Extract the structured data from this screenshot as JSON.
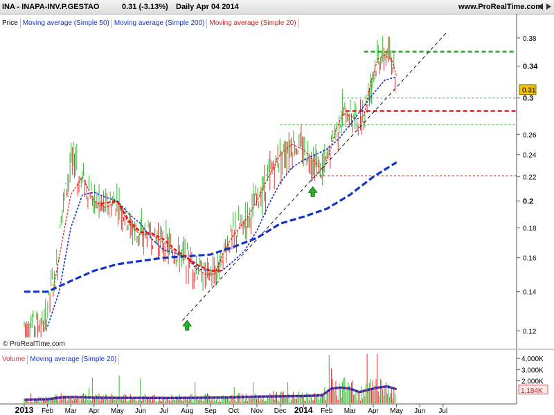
{
  "title_bar": {
    "symbol": "INA - INAPA-INV.P.GESTAO",
    "quote": "0.31 (-3.13%)",
    "period_date": "Daily  Apr 04 2014",
    "site": "www.ProRealTime.com"
  },
  "price_legend": [
    "Price",
    "Moving average (Simple 50)",
    "Moving average (Simple 200)",
    "Moving average (Simple 20)"
  ],
  "volume_legend": [
    "Volume",
    "Moving average (Simple 20)"
  ],
  "copyright": "© ProRealTime.com",
  "colors": {
    "up": "#33bb33",
    "down": "#dd3333",
    "sma20": "#ee1111",
    "sma50": "#1133cc",
    "sma200": "#1133cc",
    "level_green": "#22aa22",
    "level_red": "#ee1111",
    "last_badge": "#f2c200"
  },
  "chart_data": [
    {
      "type": "line",
      "panel": "price",
      "y_scale": "log",
      "ylim": [
        0.115,
        0.4
      ],
      "y_ticks": [
        0.12,
        0.14,
        0.16,
        0.18,
        0.2,
        0.22,
        0.24,
        0.26,
        0.3,
        0.34,
        0.38
      ],
      "y_tick_labels": [
        "0.12",
        "0.14",
        "0.16",
        "0.18",
        "0.2",
        "0.22",
        "0.24",
        "0.26",
        "0.3",
        "0.34",
        "0.38"
      ],
      "x_range_months": [
        0,
        18.5
      ],
      "last_price": 0.31,
      "last_price_label": "0.31",
      "series": [
        {
          "name": "Moving average (Simple 20)",
          "x": [
            1.3,
            2.0,
            2.5,
            3.0,
            3.5,
            4.0,
            4.5,
            5.0,
            5.5,
            6.0,
            6.5,
            7.0,
            7.4,
            7.8,
            8.2,
            8.6,
            9.0,
            9.5,
            10.0,
            10.5,
            11.0,
            11.5,
            12.0,
            12.5,
            12.8,
            13.1,
            13.4,
            13.7,
            14.0,
            14.3,
            14.6,
            14.9,
            15.2,
            15.5,
            15.8,
            16.0
          ],
          "y": [
            0.145,
            0.205,
            0.22,
            0.2,
            0.195,
            0.2,
            0.183,
            0.175,
            0.175,
            0.17,
            0.163,
            0.16,
            0.153,
            0.15,
            0.15,
            0.165,
            0.175,
            0.185,
            0.2,
            0.22,
            0.24,
            0.25,
            0.245,
            0.233,
            0.225,
            0.24,
            0.265,
            0.282,
            0.28,
            0.276,
            0.28,
            0.32,
            0.35,
            0.355,
            0.348,
            0.327
          ]
        },
        {
          "name": "Moving average (Simple 50)",
          "x": [
            1.0,
            1.5,
            2.0,
            2.5,
            3.0,
            3.5,
            4.0,
            4.5,
            5.0,
            5.5,
            6.0,
            6.5,
            7.0,
            7.5,
            8.0,
            8.5,
            9.0,
            9.5,
            10.0,
            10.5,
            11.0,
            11.5,
            12.0,
            12.5,
            13.0,
            13.5,
            14.0,
            14.5,
            15.0,
            15.5,
            16.0
          ],
          "y": [
            0.122,
            0.14,
            0.18,
            0.205,
            0.207,
            0.203,
            0.2,
            0.19,
            0.183,
            0.172,
            0.165,
            0.163,
            0.16,
            0.153,
            0.152,
            0.152,
            0.158,
            0.165,
            0.178,
            0.197,
            0.215,
            0.228,
            0.235,
            0.24,
            0.245,
            0.255,
            0.27,
            0.287,
            0.305,
            0.322,
            0.326
          ]
        },
        {
          "name": "Moving average (Simple 200)",
          "x": [
            0.0,
            1.0,
            2.0,
            3.0,
            4.0,
            5.0,
            6.0,
            7.0,
            8.0,
            9.0,
            10.0,
            11.0,
            12.0,
            13.0,
            14.0,
            15.0,
            16.0
          ],
          "y": [
            0.14,
            0.14,
            0.146,
            0.152,
            0.156,
            0.158,
            0.16,
            0.161,
            0.162,
            0.167,
            0.173,
            0.183,
            0.188,
            0.194,
            0.205,
            0.22,
            0.233
          ]
        }
      ],
      "levels": [
        {
          "value": 0.36,
          "x_start": 14.6,
          "color": "green",
          "style": "thick-dash"
        },
        {
          "value": 0.3,
          "x_start": 13.7,
          "color": "green",
          "style": "dash"
        },
        {
          "value": 0.285,
          "x_start": 13.8,
          "color": "red",
          "style": "thick-dash"
        },
        {
          "value": 0.27,
          "x_start": 11.0,
          "color": "green",
          "style": "dash"
        },
        {
          "value": 0.221,
          "x_start": 12.5,
          "color": "red",
          "style": "dash"
        }
      ],
      "trendline": {
        "x": [
          6.8,
          18.2
        ],
        "y": [
          0.125,
          0.39
        ]
      },
      "up_arrows": [
        {
          "x": 7.0,
          "y": 0.123
        },
        {
          "x": 12.4,
          "y": 0.208
        }
      ]
    },
    {
      "type": "bar",
      "panel": "volume",
      "ylim": [
        0,
        4500000
      ],
      "y_ticks": [
        2000000,
        3000000,
        4000000
      ],
      "y_tick_labels": [
        "2,000K",
        "3,000K",
        "4,000K"
      ],
      "last_volume_label": "1,184K",
      "last_volume": 1184000,
      "sma20": {
        "x": [
          0.0,
          1.0,
          1.5,
          2.0,
          3.0,
          4.0,
          5.0,
          6.0,
          7.0,
          8.0,
          9.0,
          10.0,
          11.0,
          12.0,
          12.8,
          13.2,
          13.6,
          14.0,
          14.4,
          14.8,
          15.2,
          15.6,
          16.0
        ],
        "y": [
          300000,
          350000,
          500000,
          550000,
          500000,
          480000,
          480000,
          470000,
          480000,
          500000,
          520000,
          600000,
          620000,
          650000,
          700000,
          1300000,
          1400000,
          1300000,
          1000000,
          1200000,
          1400000,
          1500000,
          1250000
        ]
      }
    }
  ],
  "x_axis": {
    "labels": [
      "2013",
      "Feb",
      "Mar",
      "Apr",
      "May",
      "Jun",
      "Jul",
      "Aug",
      "Sep",
      "Oct",
      "Nov",
      "Dec",
      "2014",
      "Feb",
      "Mar",
      "Apr",
      "May",
      "Jun",
      "Jul"
    ]
  }
}
